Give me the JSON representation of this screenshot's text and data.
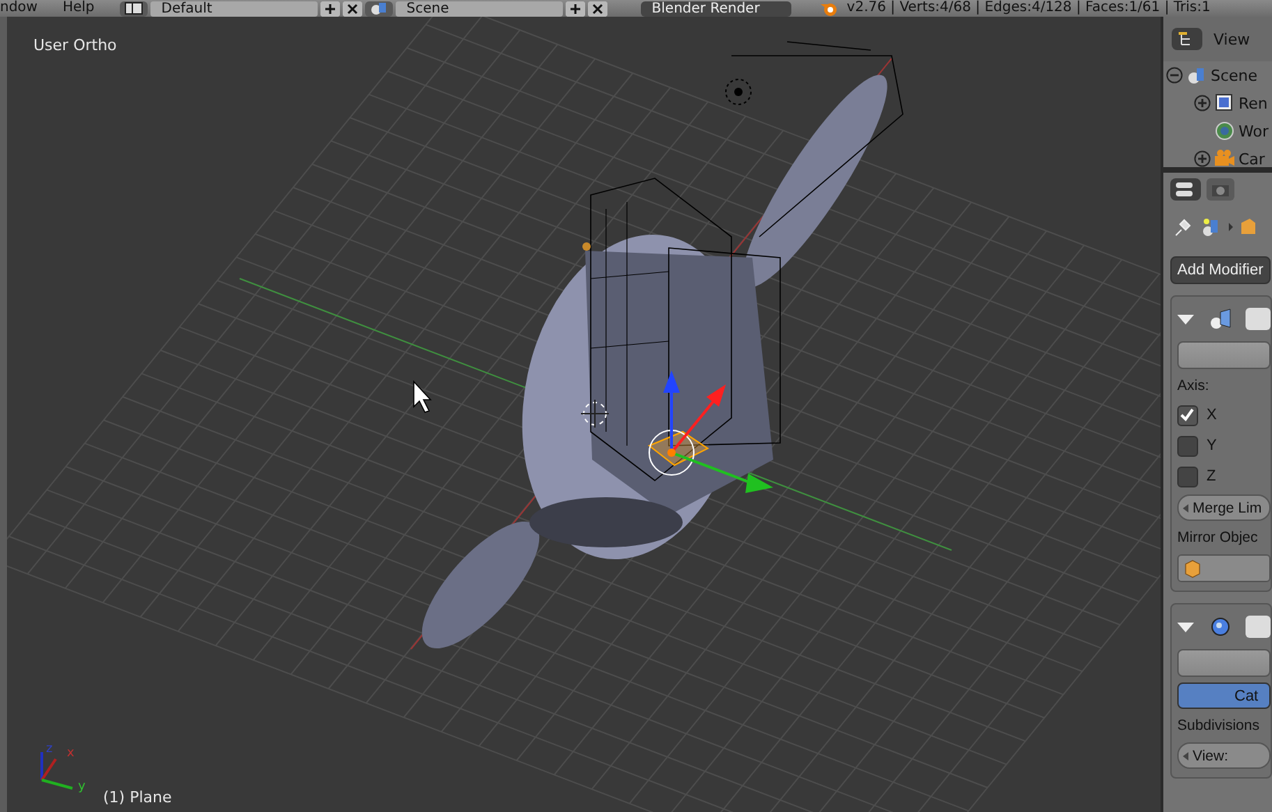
{
  "top_bar": {
    "menus": [
      "ndow",
      "Help"
    ],
    "screen_layout": "Default",
    "scene": "Scene",
    "render_engine": "Blender Render",
    "stats": "v2.76 | Verts:4/68 | Edges:4/128 | Faces:1/61 | Tris:1"
  },
  "viewport": {
    "view_label": "User Ortho",
    "object_label": "(1) Plane",
    "axes": [
      "z",
      "x",
      "y"
    ]
  },
  "outliner": {
    "header": "View",
    "items": [
      {
        "label": "Scene",
        "expanded": true,
        "kind": "scene",
        "children": [
          {
            "label": "Ren",
            "expanded": false,
            "kind": "render"
          },
          {
            "label": "Wor",
            "kind": "world"
          },
          {
            "label": "Car",
            "expanded": false,
            "kind": "camera"
          }
        ]
      }
    ]
  },
  "properties": {
    "add_modifier": "Add Modifier",
    "modifiers": [
      {
        "kind": "mirror",
        "axis_label": "Axis:",
        "axes": [
          {
            "label": "X",
            "checked": true
          },
          {
            "label": "Y",
            "checked": false
          },
          {
            "label": "Z",
            "checked": false
          }
        ],
        "merge": "Merge Lim",
        "mirror_object_label": "Mirror Objec"
      },
      {
        "kind": "subsurf",
        "options": [
          {
            "label": "Cat",
            "selected": true
          }
        ],
        "subdivisions_label": "Subdivisions",
        "view": "View:"
      }
    ]
  }
}
